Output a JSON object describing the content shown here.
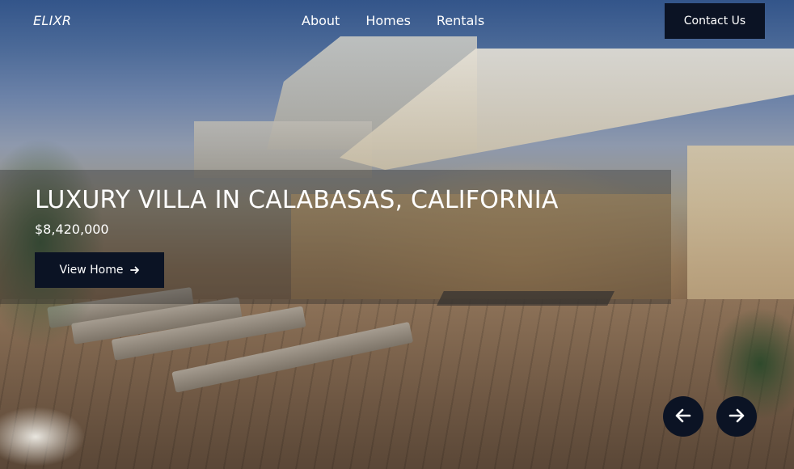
{
  "brand": {
    "logo_text": "ELIXR"
  },
  "nav": {
    "items": [
      {
        "label": "About"
      },
      {
        "label": "Homes"
      },
      {
        "label": "Rentals"
      }
    ],
    "contact_label": "Contact Us"
  },
  "hero": {
    "title": "LUXURY VILLA IN CALABASAS, CALIFORNIA",
    "price": "$8,420,000",
    "cta_label": "View Home",
    "cta_icon": "arrow-right-icon",
    "background_image": "house exterior with pool deck and lounge chairs at dusk"
  },
  "carousel": {
    "prev_icon": "arrow-left-icon",
    "next_icon": "arrow-right-icon"
  },
  "colors": {
    "button_bg": "#0b1324",
    "text": "#ffffff",
    "panel_overlay": "rgba(40,40,40,0.38)"
  }
}
